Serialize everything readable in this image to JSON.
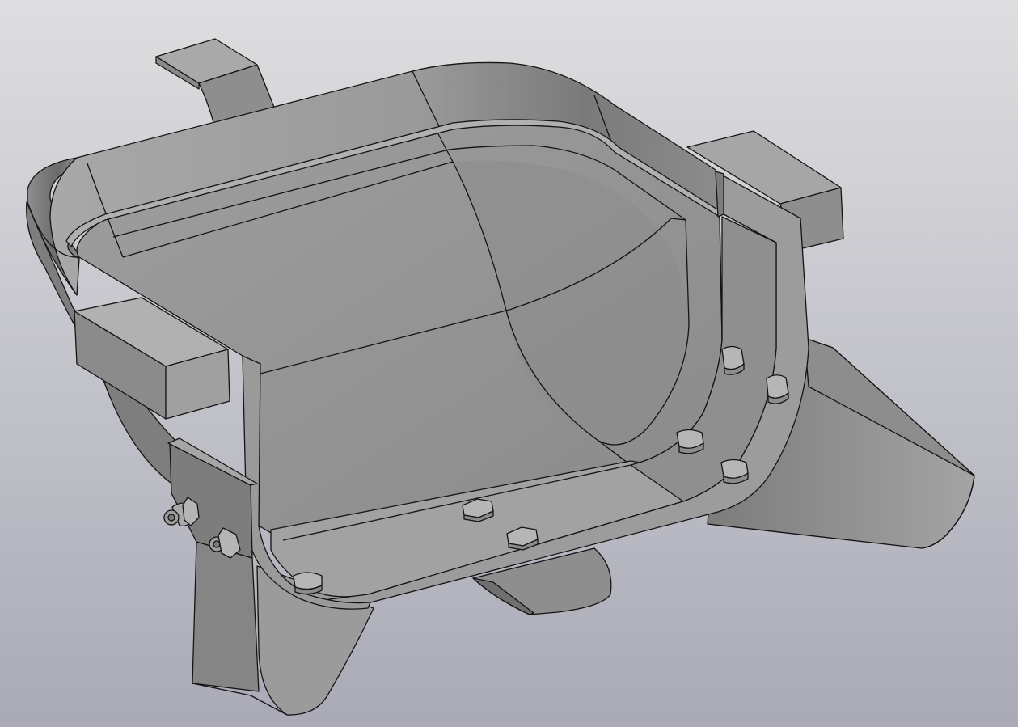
{
  "viewport": {
    "background_top": "#dedee0",
    "background_bottom": "#a9aab6"
  },
  "model": {
    "surface_light": "#b2b2b2",
    "surface_mid": "#9a9a9a",
    "surface_dark": "#6e6e6e",
    "edge_color": "#141414"
  }
}
